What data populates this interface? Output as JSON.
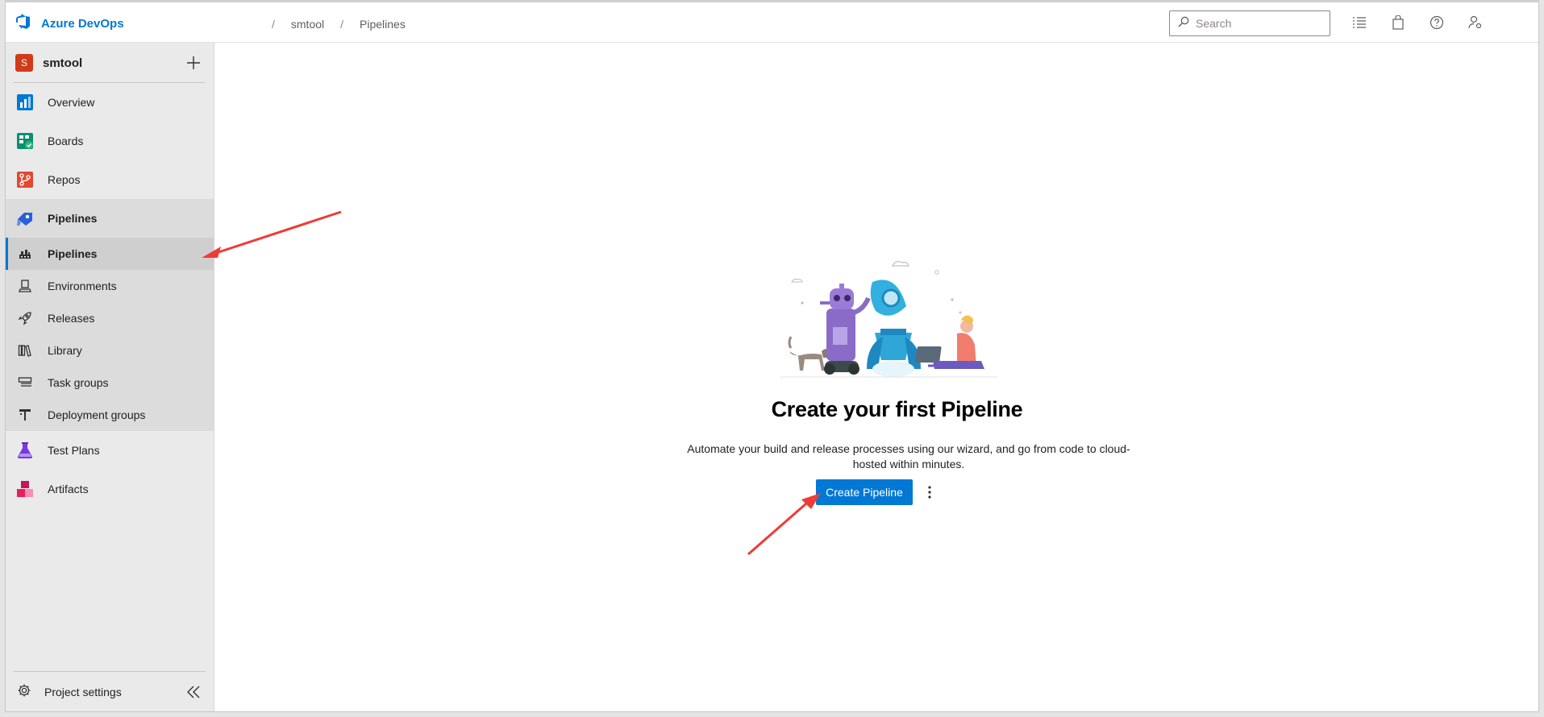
{
  "app": {
    "title": "Azure DevOps"
  },
  "breadcrumb": {
    "items": [
      "smtool",
      "Pipelines"
    ],
    "separator": "/"
  },
  "search": {
    "placeholder": "Search"
  },
  "project": {
    "initial": "S",
    "name": "smtool"
  },
  "sidebar": {
    "items": [
      {
        "label": "Overview",
        "icon": "overview-icon"
      },
      {
        "label": "Boards",
        "icon": "boards-icon"
      },
      {
        "label": "Repos",
        "icon": "repos-icon"
      }
    ],
    "pipelines_group": {
      "label": "Pipelines",
      "sub_items": [
        {
          "label": "Pipelines",
          "icon": "pipelines-sub-icon",
          "selected": true
        },
        {
          "label": "Environments",
          "icon": "environments-icon"
        },
        {
          "label": "Releases",
          "icon": "releases-icon"
        },
        {
          "label": "Library",
          "icon": "library-icon"
        },
        {
          "label": "Task groups",
          "icon": "task-groups-icon"
        },
        {
          "label": "Deployment groups",
          "icon": "deployment-groups-icon"
        }
      ]
    },
    "after": [
      {
        "label": "Test Plans",
        "icon": "test-plans-icon"
      },
      {
        "label": "Artifacts",
        "icon": "artifacts-icon"
      }
    ],
    "settings_label": "Project settings"
  },
  "empty_state": {
    "title": "Create your first Pipeline",
    "description": "Automate your build and release processes using our wizard, and go from code to cloud-hosted within minutes.",
    "button_label": "Create Pipeline"
  },
  "colors": {
    "accent": "#0078d4",
    "annotation": "#ef3b36"
  }
}
